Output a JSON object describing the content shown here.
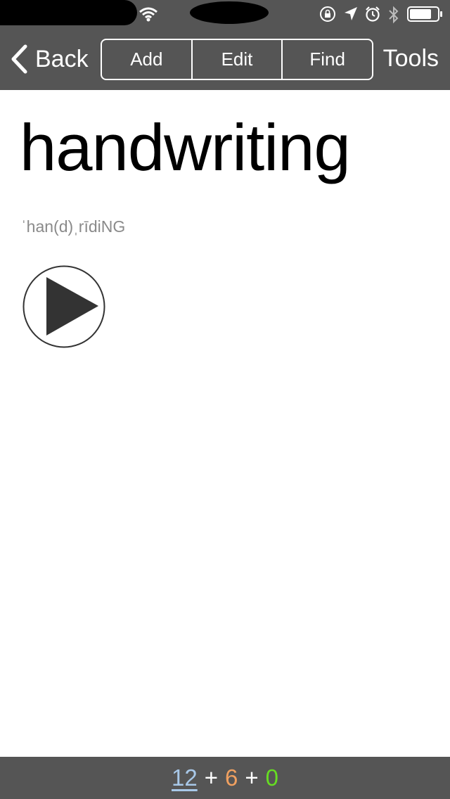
{
  "status_bar": {
    "icons": [
      "wifi-icon",
      "rotation-lock-icon",
      "location-arrow-icon",
      "alarm-icon",
      "bluetooth-icon",
      "battery-icon"
    ]
  },
  "nav": {
    "back_label": "Back",
    "segments": [
      "Add",
      "Edit",
      "Find"
    ],
    "tools_label": "Tools"
  },
  "entry": {
    "word": "handwriting",
    "pronunciation": "ˈhan(d)ˌrīdiNG",
    "play_icon": "play-icon"
  },
  "counts": {
    "new": "12",
    "plus1": "+",
    "learning": "6",
    "plus2": "+",
    "review": "0"
  },
  "colors": {
    "bar_bg": "#555555",
    "count_new": "#a8c8e8",
    "count_learning": "#f0a060",
    "count_review": "#66dd22"
  }
}
